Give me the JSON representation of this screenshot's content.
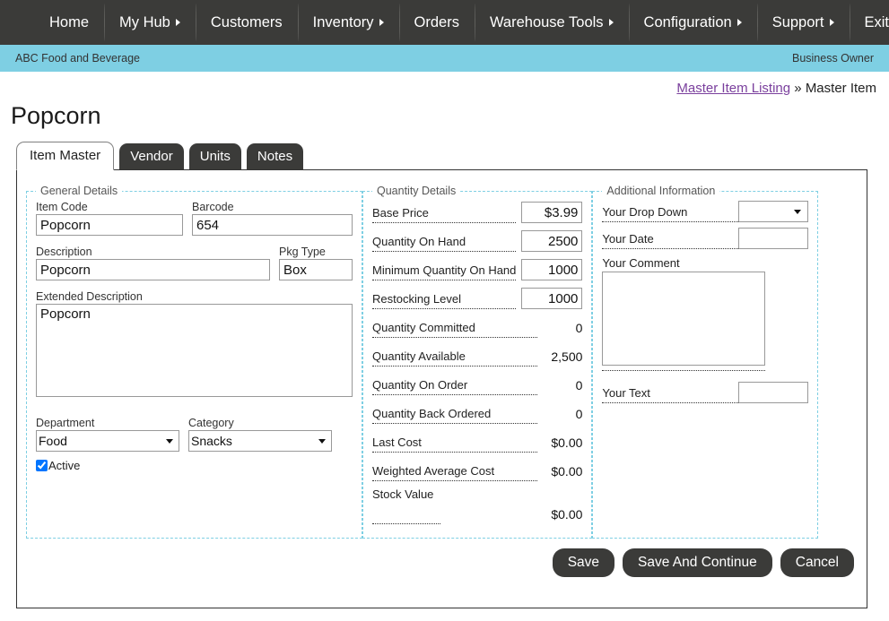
{
  "nav": {
    "items": [
      {
        "label": "Home",
        "has_caret": false
      },
      {
        "label": "My Hub",
        "has_caret": true
      },
      {
        "label": "Customers",
        "has_caret": false
      },
      {
        "label": "Inventory",
        "has_caret": true
      },
      {
        "label": "Orders",
        "has_caret": false
      },
      {
        "label": "Warehouse Tools",
        "has_caret": true
      },
      {
        "label": "Configuration",
        "has_caret": true
      },
      {
        "label": "Support",
        "has_caret": true
      },
      {
        "label": "Exit",
        "has_caret": false
      }
    ]
  },
  "banner": {
    "company": "ABC Food and Beverage",
    "role": "Business Owner",
    "background": "#7ecfe3"
  },
  "breadcrumb": {
    "link": "Master Item Listing",
    "separator": "»",
    "current": "Master Item",
    "link_color": "#7a3f9d"
  },
  "page": {
    "title": "Popcorn"
  },
  "tabs": [
    {
      "label": "Item Master",
      "active": true
    },
    {
      "label": "Vendor",
      "active": false
    },
    {
      "label": "Units",
      "active": false
    },
    {
      "label": "Notes",
      "active": false
    }
  ],
  "general_details": {
    "legend": "General Details",
    "item_code": {
      "label": "Item Code",
      "value": "Popcorn"
    },
    "barcode": {
      "label": "Barcode",
      "value": "654"
    },
    "description": {
      "label": "Description",
      "value": "Popcorn"
    },
    "pkg_type": {
      "label": "Pkg Type",
      "value": "Box"
    },
    "extended_description": {
      "label": "Extended Description",
      "value": "Popcorn"
    },
    "department": {
      "label": "Department",
      "value": "Food"
    },
    "category": {
      "label": "Category",
      "value": "Snacks"
    },
    "active": {
      "label": "Active",
      "checked": true
    }
  },
  "quantity_details": {
    "legend": "Quantity Details",
    "rows": [
      {
        "label": "Base Price",
        "value": "$3.99",
        "editable": true
      },
      {
        "label": "Quantity On Hand",
        "value": "2500",
        "editable": true
      },
      {
        "label": "Minimum Quantity On Hand",
        "value": "1000",
        "editable": true
      },
      {
        "label": "Restocking Level",
        "value": "1000",
        "editable": true
      },
      {
        "label": "Quantity Committed",
        "value": "0",
        "editable": false
      },
      {
        "label": "Quantity Available",
        "value": "2,500",
        "editable": false
      },
      {
        "label": "Quantity On Order",
        "value": "0",
        "editable": false
      },
      {
        "label": "Quantity Back Ordered",
        "value": "0",
        "editable": false
      },
      {
        "label": "Last Cost",
        "value": "$0.00",
        "editable": false
      },
      {
        "label": "Weighted Average Cost",
        "value": "$0.00",
        "editable": false
      }
    ],
    "stock_value": {
      "label": "Stock Value",
      "value": "$0.00"
    }
  },
  "additional_information": {
    "legend": "Additional Information",
    "drop_down": {
      "label": "Your Drop Down",
      "value": ""
    },
    "date": {
      "label": "Your Date",
      "value": ""
    },
    "comment": {
      "label": "Your Comment",
      "value": ""
    },
    "text": {
      "label": "Your Text",
      "value": ""
    }
  },
  "buttons": {
    "save": "Save",
    "save_and_continue": "Save And Continue",
    "cancel": "Cancel"
  }
}
